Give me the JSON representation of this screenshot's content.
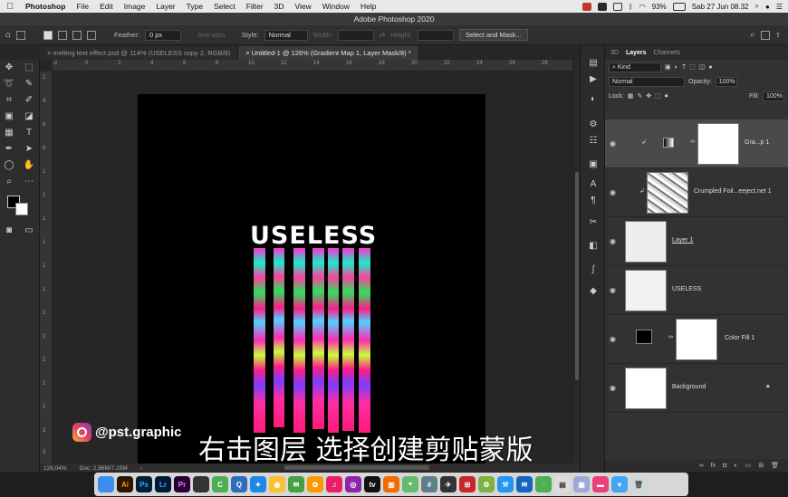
{
  "menubar": {
    "apple": "",
    "app": "Photoshop",
    "items": [
      "File",
      "Edit",
      "Image",
      "Layer",
      "Type",
      "Select",
      "Filter",
      "3D",
      "View",
      "Window",
      "Help"
    ],
    "battery": "93%",
    "datetime": "Sab 27 Jun  08.32"
  },
  "window": {
    "title": "Adobe Photoshop 2020"
  },
  "options": {
    "feather_label": "Feather:",
    "feather_value": "0 px",
    "antialias": "Anti-alias",
    "style_label": "Style:",
    "style_value": "Normal",
    "width_label": "Width:",
    "height_label": "Height:",
    "select_mask": "Select and Mask..."
  },
  "tabs": [
    {
      "label": "melting text effect.psd @ 114% (USELESS copy 2, RGB/8)"
    },
    {
      "label": "Untitled-1 @ 126% (Gradient Map 1, Layer Mask/8) *"
    }
  ],
  "ruler_h": [
    "-2",
    "0",
    "2",
    "4",
    "6",
    "8",
    "10",
    "12",
    "14",
    "16",
    "18",
    "20",
    "22",
    "24",
    "26",
    "28"
  ],
  "ruler_v": [
    "2",
    "4",
    "6",
    "8",
    "1",
    "1",
    "1",
    "1",
    "1",
    "1",
    "2",
    "2",
    "2",
    "2",
    "2",
    "3",
    "3"
  ],
  "canvas": {
    "headline": "USELESS"
  },
  "drip_colors": {
    "pink": "#ff1b8b",
    "green": "#29e35c",
    "cyan": "#4fd3ff"
  },
  "status": {
    "zoom": "126,04%",
    "doc": "Doc: 2,86M/7,15M"
  },
  "panel": {
    "tabs": [
      "3D",
      "Layers",
      "Channels"
    ],
    "kind": "Kind",
    "blend": "Normal",
    "opacity_label": "Opacity:",
    "opacity": "100%",
    "lock_label": "Lock:",
    "fill_label": "Fill:",
    "fill": "100%",
    "layers": [
      {
        "name": "Gra...p 1"
      },
      {
        "name": "Crumpled Foil...eeject.net 1"
      },
      {
        "name": "Layer 1"
      },
      {
        "name": "USELESS"
      },
      {
        "name": "Color Fill 1"
      },
      {
        "name": "Background"
      }
    ]
  },
  "watermark": {
    "handle": "@pst.graphic"
  },
  "subtitle": "右击图层 选择创建剪贴蒙版",
  "dock": [
    "Finder",
    "Ai",
    "Ps",
    "Lr",
    "Pr",
    "App",
    "Camo",
    "Q",
    "Safari",
    "Chrome",
    "Msg",
    "Photos",
    "Music",
    "Podcasts",
    "TV",
    "Books",
    "Maps",
    "Slack",
    "Android",
    "Xcode",
    "Mail",
    "WeChat",
    "Files",
    "Preview",
    "Notes",
    "Downloads",
    "Trash"
  ]
}
